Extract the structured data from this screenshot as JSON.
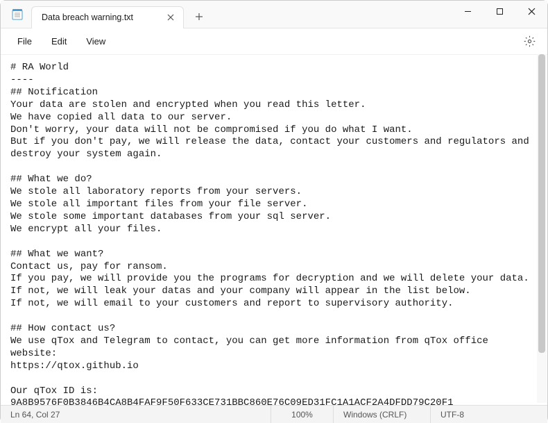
{
  "window": {
    "tab_title": "Data breach warning.txt"
  },
  "menu": {
    "file": "File",
    "edit": "Edit",
    "view": "View"
  },
  "document": {
    "lines": [
      "# RA World",
      "----",
      "## Notification",
      "Your data are stolen and encrypted when you read this letter.",
      "We have copied all data to our server.",
      "Don't worry, your data will not be compromised if you do what I want.",
      "But if you don't pay, we will release the data, contact your customers and regulators and destroy your system again.",
      "",
      "## What we do?",
      "We stole all laboratory reports from your servers.",
      "We stole all important files from your file server.",
      "We stole some important databases from your sql server.",
      "We encrypt all your files.",
      "",
      "## What we want?",
      "Contact us, pay for ransom.",
      "If you pay, we will provide you the programs for decryption and we will delete your data.",
      "If not, we will leak your datas and your company will appear in the list below.",
      "If not, we will email to your customers and report to supervisory authority.",
      "",
      "## How contact us?",
      "We use qTox and Telegram to contact, you can get more information from qTox office website:",
      "https://qtox.github.io",
      "",
      "Our qTox ID is:",
      "9A8B9576F0B3846B4CA8B4FAF9F50F633CE731BBC860E76C09ED31FC1A1ACF2A4DFDD79C20F1"
    ]
  },
  "status": {
    "position": "Ln 64, Col 27",
    "zoom": "100%",
    "line_ending": "Windows (CRLF)",
    "encoding": "UTF-8"
  }
}
